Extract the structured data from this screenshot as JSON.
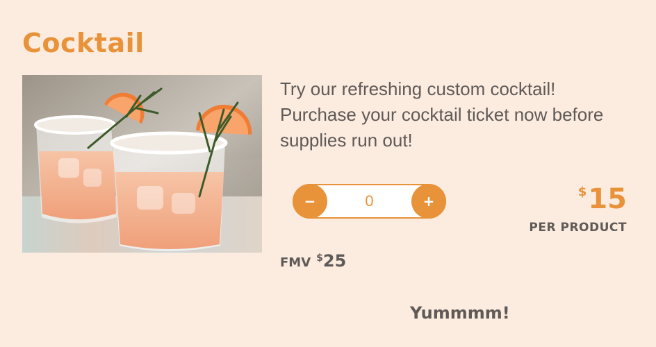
{
  "product": {
    "title": "Cocktail",
    "image_alt_icon": "cocktail-photo",
    "description": "Try our refreshing custom cocktail! Purchase your cocktail ticket now before supplies run out!",
    "quantity": {
      "minus_label": "−",
      "value": "0",
      "plus_label": "+"
    },
    "price": {
      "currency": "$",
      "amount": "15",
      "unit_label": "PER PRODUCT"
    },
    "fmv": {
      "label": "FMV",
      "currency": "$",
      "amount": "25"
    },
    "tagline": "Yummmm!"
  },
  "colors": {
    "background": "#fcece0",
    "accent": "#e8923a",
    "text": "#5f5a57"
  }
}
